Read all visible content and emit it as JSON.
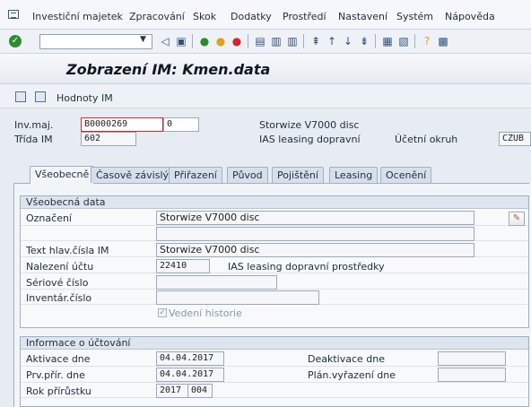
{
  "menu": {
    "items": [
      "Investiční majetek",
      "Zpracování",
      "Skok",
      "Dodatky",
      "Prostředí",
      "Nastavení",
      "Systém",
      "Nápověda"
    ]
  },
  "toolbar": {
    "command_field": "",
    "icons": [
      "enter-icon",
      "back-icon",
      "save-icon",
      "back-nav-icon",
      "exit-icon",
      "cancel-icon",
      "print-icon",
      "find-icon",
      "find-next-icon",
      "first-page-icon",
      "prev-page-icon",
      "next-page-icon",
      "last-page-icon",
      "create-session-icon",
      "shortcut-icon",
      "help-icon",
      "layout-icon"
    ]
  },
  "title": "Zobrazení IM:  Kmen.data",
  "app_toolbar": {
    "hodnoty_label": "Hodnoty IM"
  },
  "header": {
    "inv_maj_label": "Inv.maj.",
    "inv_maj_value": "B0000269",
    "inv_maj_sub": "0",
    "inv_maj_desc": "Storwize V7000 disc",
    "trida_label": "Třída IM",
    "trida_value": "602",
    "trida_desc": "IAS leasing dopravní",
    "ucetni_okruh_label": "Účetní okruh",
    "ucetni_okruh_value": "CZUB"
  },
  "tabs": [
    "Všeobecně",
    "Časově závislý",
    "Přiřazení",
    "Původ",
    "Pojištění",
    "Leasing",
    "Ocenění"
  ],
  "general_data": {
    "group_title": "Všeobecná data",
    "oznaceni_label": "Označení",
    "oznaceni_value": "Storwize V7000 disc",
    "oznaceni_value2": "",
    "text_hlav_label": "Text hlav.čísla IM",
    "text_hlav_value": "Storwize V7000 disc",
    "nalezeni_label": "Nalezení účtu",
    "nalezeni_value": "22410",
    "nalezeni_desc": "IAS leasing dopravní prostředky",
    "seriove_label": "Sériové číslo",
    "seriove_value": "",
    "inventar_label": "Inventár.číslo",
    "inventar_value": "",
    "vedeni_label": "Vedení historie",
    "vedeni_checked": true
  },
  "posting_info": {
    "group_title": "Informace o účtování",
    "aktivace_label": "Aktivace dne",
    "aktivace_value": "04.04.2017",
    "prv_label": "Prv.přír. dne",
    "prv_value": "04.04.2017",
    "rok_label": "Rok přírůstku",
    "rok_value": "2017",
    "rok_period": "004",
    "deaktivace_label": "Deaktivace dne",
    "deaktivace_value": "",
    "plan_label": "Plán.vyřazení dne",
    "plan_value": ""
  }
}
